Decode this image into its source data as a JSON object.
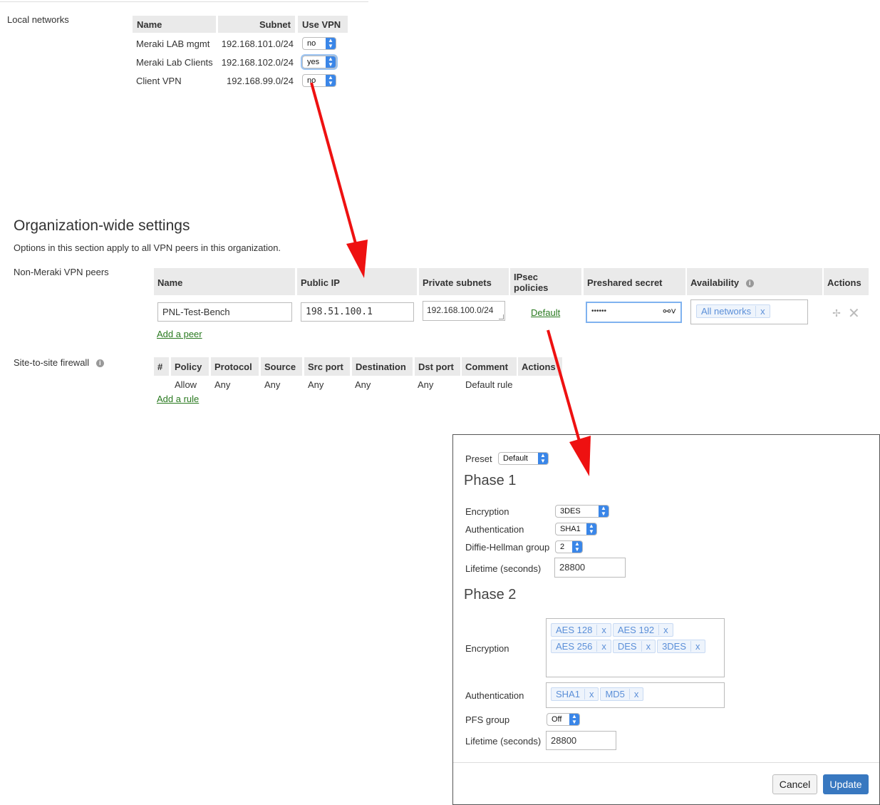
{
  "local_networks": {
    "label": "Local networks",
    "headers": [
      "Name",
      "Subnet",
      "Use VPN"
    ],
    "rows": [
      {
        "name": "Meraki LAB mgmt",
        "subnet": "192.168.101.0/24",
        "use_vpn": "no"
      },
      {
        "name": "Meraki Lab Clients",
        "subnet": "192.168.102.0/24",
        "use_vpn": "yes"
      },
      {
        "name": "Client VPN",
        "subnet": "192.168.99.0/24",
        "use_vpn": "no"
      }
    ]
  },
  "org_settings": {
    "title": "Organization-wide settings",
    "subtitle": "Options in this section apply to all VPN peers in this organization."
  },
  "peers": {
    "label": "Non-Meraki VPN peers",
    "headers": {
      "name": "Name",
      "public_ip": "Public IP",
      "private_subnets": "Private subnets",
      "ipsec_1": "IPsec",
      "ipsec_2": "policies",
      "preshared": "Preshared secret",
      "availability": "Availability",
      "actions": "Actions"
    },
    "row": {
      "name": "PNL-Test-Bench",
      "public_ip": "198.51.100.1",
      "private_subnets": "192.168.100.0/24",
      "ipsec_policy": "Default",
      "preshared_secret": "••••••",
      "availability_tag": "All networks"
    },
    "add_link": "Add a peer"
  },
  "firewall": {
    "label": "Site-to-site firewall",
    "headers": [
      "#",
      "Policy",
      "Protocol",
      "Source",
      "Src port",
      "Destination",
      "Dst port",
      "Comment",
      "Actions"
    ],
    "row": [
      "",
      "Allow",
      "Any",
      "Any",
      "Any",
      "Any",
      "Any",
      "Default rule",
      ""
    ],
    "add_link": "Add a rule"
  },
  "dialog": {
    "preset_label": "Preset",
    "preset_value": "Default",
    "phase1": {
      "title": "Phase 1",
      "encryption_label": "Encryption",
      "encryption_value": "3DES",
      "auth_label": "Authentication",
      "auth_value": "SHA1",
      "dh_label": "Diffie-Hellman group",
      "dh_value": "2",
      "lifetime_label": "Lifetime (seconds)",
      "lifetime_value": "28800"
    },
    "phase2": {
      "title": "Phase 2",
      "encryption_label": "Encryption",
      "encryption_tags": [
        "AES 128",
        "AES 192",
        "AES 256",
        "DES",
        "3DES"
      ],
      "auth_label": "Authentication",
      "auth_tags": [
        "SHA1",
        "MD5"
      ],
      "pfs_label": "PFS group",
      "pfs_value": "Off",
      "lifetime_label": "Lifetime (seconds)",
      "lifetime_value": "28800"
    },
    "cancel": "Cancel",
    "update": "Update"
  },
  "tag_remove": "x",
  "info_glyph": "i",
  "colors": {
    "accent_blue": "#3a86e8",
    "link_green": "#2a7a20",
    "update_button": "#3878c0",
    "annotation_arrow": "#ee1111"
  }
}
